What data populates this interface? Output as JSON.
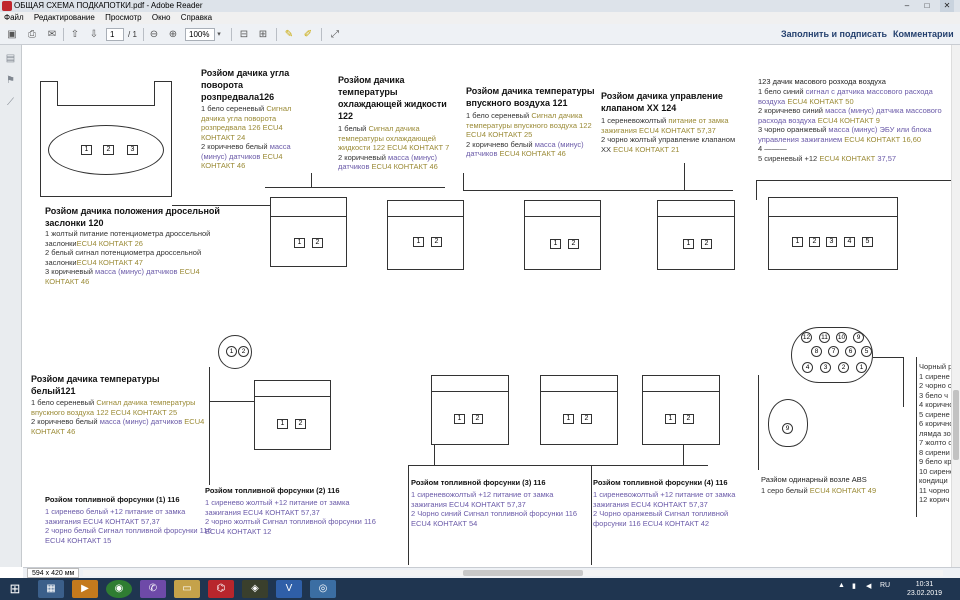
{
  "window": {
    "title": "ОБЩАЯ СХЕМА ПОДКАПОТКИ.pdf - Adobe Reader",
    "controls": [
      "–",
      "□",
      "✕"
    ]
  },
  "menu": [
    "Файл",
    "Редактирование",
    "Просмотр",
    "Окно",
    "Справка"
  ],
  "toolbar": {
    "page_current": "1",
    "page_total": "/ 1",
    "zoom": "100%",
    "fill_sign": "Заполнить и подписать",
    "comments": "Комментарии"
  },
  "doc": {
    "sensor126": {
      "title": "Розйом дачика угла поворота розпредвала126",
      "l1a": "1 бело сереневый ",
      "l1b": "Сигнал дачика угла поворота розпредвала 126 ECU4 КОНТАКТ 24",
      "l2a": " 2 коричнево белый ",
      "l2b": "масса (минус) датчиков",
      "l2c": " ECU4 КОНТАКТ 46"
    },
    "sensor122": {
      "title": "Розйом дачика температуры охлаждающей жидкости 122",
      "l1a": "1 белый ",
      "l1b": "Сигнал дачика температуры охлаждающей жидкости 122 ECU4 КОНТАКТ 7",
      "l2a": " 2 коричневый ",
      "l2b": "масса (минус) датчиков",
      "l2c": " ECU4 КОНТАКТ 46"
    },
    "sensor121a": {
      "title": "Розйом дачика температуры впускного воздуха 121",
      "l1a": "1 бело сереневый ",
      "l1b": "Сигнал дачика температуры впускного воздуха 122 ECU4 КОНТАКТ 25",
      "l2a": " 2 коричнево белый ",
      "l2b": "масса (минус) датчиков",
      "l2c": " ECU4 КОНТАКТ 46"
    },
    "idle124": {
      "title": "Розйом дачика управление клапаном ХХ 124",
      "l1a": "1 сереневожолтый ",
      "l1b": "питание от замка зажигания",
      "l1c": " ECU4 КОНТАКТ 57,37",
      "l2a": " 2 чорно жолтый управление клапаном ХХ ",
      "l2b": "ECU4 КОНТАКТ 21"
    },
    "maf123": {
      "title": "123 дачик масового розхода воздуха",
      "l1a": "1 бело синий ",
      "l1b": "сигнал с датчика массового расхода воздуха",
      "l1c": " ECU4 КОНТАКТ 50",
      "l2a": "2 коричнево синий  ",
      "l2b": "масса (минус) датчика массового расхода воздуха",
      "l2c": " ECU4 КОНТАКТ 9",
      "l3a": "3 чорно оранжевый ",
      "l3b": "масса (минус) ЭБУ или блока управления зажиганием",
      "l3c": " ECU4 КОНТАКТ 16,60",
      "l4": "4 ———",
      "l5a": "5 сиреневый +12 ",
      "l5b": "ECU4 КОНТАКТ",
      "l5c": " 37,57"
    },
    "throttle120": {
      "title": "Розйом дачика положения дросельной заслонки 120",
      "l1a": "1 жолтый питание потенциометра дроссельной заслонки",
      "l1b": "ECU4 КОНТАКТ  26",
      "l2a": "2 белый  сигнал потенциометра дроссельной заслонки",
      "l2b": "ECU4 КОНТАКТ  47",
      "l3a": "3 коричневый ",
      "l3b": "масса (минус) датчиков",
      "l3c": " ECU4 КОНТАКТ 46"
    },
    "sensor121b": {
      "title": "Розйом дачика температуры белый121",
      "l1a": "1 бело сереневый ",
      "l1b": "Сигнал дачика температуры впускного воздуха 122 ECU4 КОНТАКТ 25",
      "l2a": " 2 коричнево белый ",
      "l2b": "масса (минус) датчиков",
      "l2c": " ECU4 КОНТАКТ 46"
    },
    "inj1": {
      "title": "Розйом топливной форсунки (1) 116",
      "l1": "1 сиренево белый +12 питание от замка зажигания ECU4 КОНТАКТ 57,37",
      "l2": "2 чорно белый Сигнал  топливной форсунки 116 ECU4 КОНТАКТ 15"
    },
    "inj2": {
      "title": "Розйом топливной форсунки (2) 116",
      "l1": "1 сиренево жолтый +12 питание от замка зажигания ECU4 КОНТАКТ 57,37",
      "l2": "2 чорно жолтый Сигнал  топливной форсунки 116 ECU4 КОНТАКТ 12"
    },
    "inj3": {
      "title": "Розйом топливной форсунки (3) 116",
      "l1": "1 сиреневожолтый  +12 питание от замка зажигания ECU4 КОНТАКТ 57,37",
      "l2": "2 Чорно синий Сигнал  топливной форсунки 116 ECU4 КОНТАКТ 54"
    },
    "inj4": {
      "title": "Розйом топливной форсунки (4) 116",
      "l1": "1 сиреневожолтый +12 питание от замка зажигания ECU4 КОНТАКТ 57,37",
      "l2": "2 Чорно оранжевый Сигнал  топливной форсунки 116 ECU4 КОНТАКТ 42"
    },
    "abs": {
      "title": "Разйом одинарный возле ABS",
      "l1a": "1 серо белый ",
      "l1b": "ECU4 КОНТАКТ 49"
    },
    "right_partial": [
      "Чорный р",
      "1 сирене",
      "2 чорно с",
      "3 бело ч",
      "4 корично",
      "5 сирене",
      "6 корично",
      "лямда зо",
      "7 жолто с",
      "8 сирени",
      "9 бело кр",
      "10 сирене",
      "кондици",
      "11 чорно",
      "12 корич"
    ],
    "pin_labels": [
      "1",
      "2",
      "3",
      "4",
      "5",
      "6",
      "7",
      "8",
      "9",
      "10",
      "11",
      "12"
    ]
  },
  "statusbar": {
    "size": "594 x 420 мм"
  },
  "clock": {
    "time": "10:31",
    "date": "23.02.2019"
  },
  "tray": {
    "lang": "RU"
  }
}
